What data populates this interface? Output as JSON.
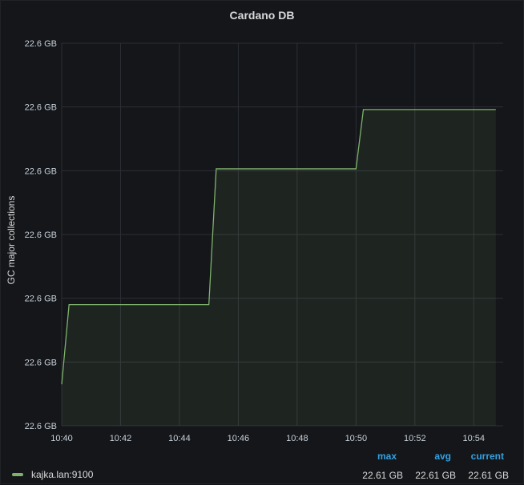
{
  "panel": {
    "title": "Cardano DB"
  },
  "colors": {
    "background": "#141619",
    "grid": "#2c2f36",
    "series": "#7eb26d",
    "legend_header": "#33a2e5"
  },
  "legend": {
    "series_name": "kajka.lan:9100",
    "headers": {
      "max": "max",
      "avg": "avg",
      "current": "current"
    },
    "values": {
      "max": "22.61 GB",
      "avg": "22.61 GB",
      "current": "22.61 GB"
    }
  },
  "chart_data": {
    "type": "area",
    "ylabel": "GC major collections",
    "x_ticks": [
      "10:40",
      "10:42",
      "10:44",
      "10:46",
      "10:48",
      "10:50",
      "10:52",
      "10:54"
    ],
    "y_ticks": [
      "22.6 GB",
      "22.6 GB",
      "22.6 GB",
      "22.6 GB",
      "22.6 GB",
      "22.6 GB",
      "22.6 GB"
    ],
    "xlim": [
      "10:40",
      "10:55:00"
    ],
    "ylim": [
      0,
      6
    ],
    "grid": true,
    "legend_position": "bottom",
    "series": [
      {
        "name": "kajka.lan:9100",
        "points": [
          {
            "x": "10:40:00",
            "y": 0.65
          },
          {
            "x": "10:40:15",
            "y": 1.9
          },
          {
            "x": "10:45:00",
            "y": 1.9
          },
          {
            "x": "10:45:15",
            "y": 4.03
          },
          {
            "x": "10:50:00",
            "y": 4.03
          },
          {
            "x": "10:50:15",
            "y": 4.96
          },
          {
            "x": "10:54:45",
            "y": 4.96
          }
        ]
      }
    ]
  }
}
